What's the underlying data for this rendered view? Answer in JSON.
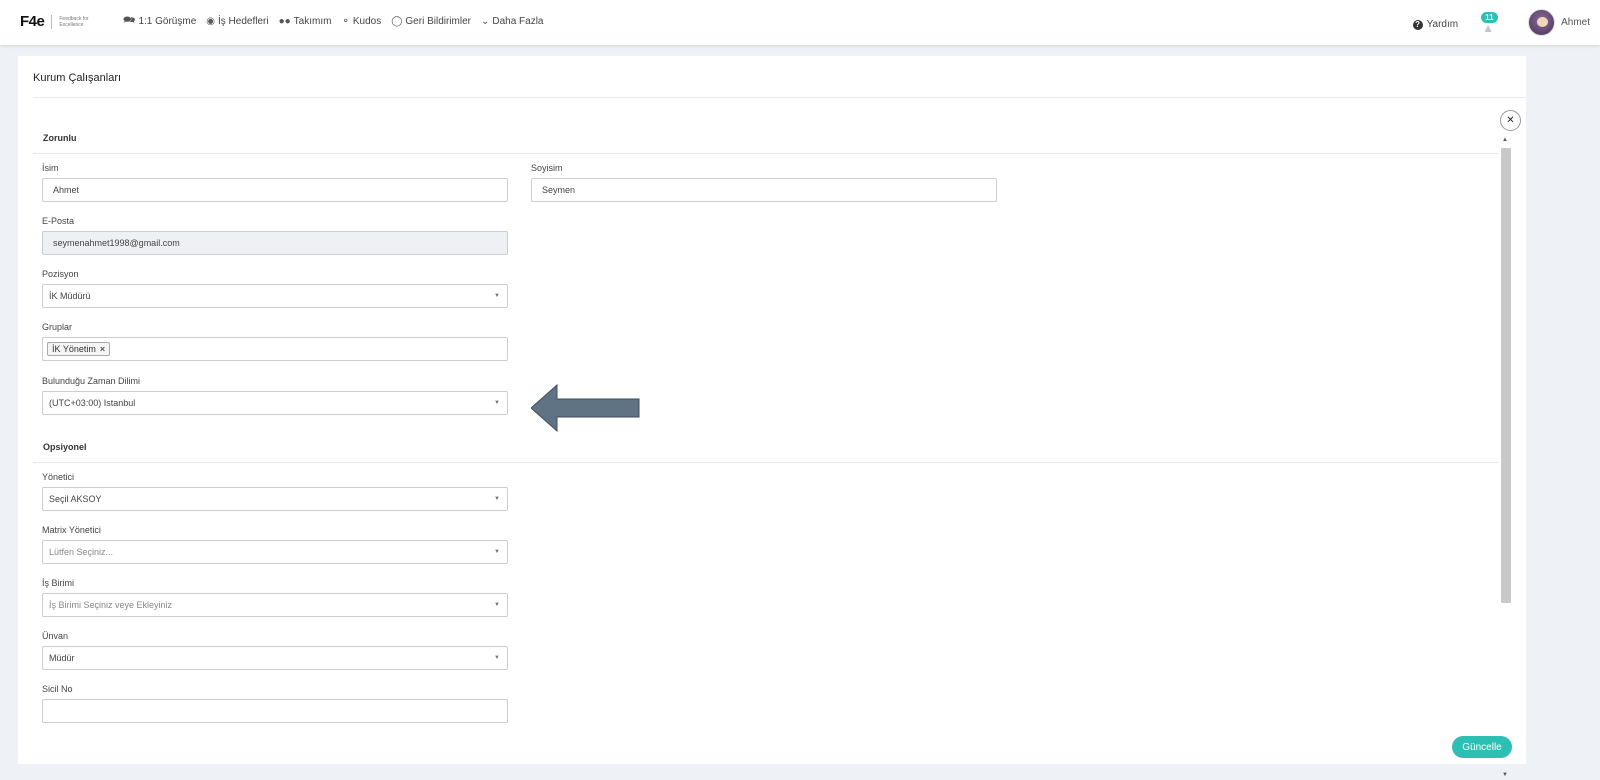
{
  "logo": {
    "mark": "F4e",
    "tagline": "Feedback for Excellence"
  },
  "nav": {
    "items": [
      {
        "label": "1:1 Görüşme",
        "icon": "chat-icon"
      },
      {
        "label": "İş Hedefleri",
        "icon": "target-icon"
      },
      {
        "label": "Takımım",
        "icon": "team-icon"
      },
      {
        "label": "Kudos",
        "icon": "award-icon"
      },
      {
        "label": "Geri Bildirimler",
        "icon": "comment-icon"
      },
      {
        "label": "Daha Fazla",
        "icon": "chevron-down-icon"
      }
    ],
    "help_label": "Yardım",
    "notification_count": "11",
    "user_name": "Ahmet"
  },
  "page": {
    "title": "Kurum Çalışanları",
    "submit_label": "Güncelle"
  },
  "form": {
    "required_section": "Zorunlu",
    "optional_section": "Opsiyonel",
    "first_name": {
      "label": "İsim",
      "value": "Ahmet"
    },
    "last_name": {
      "label": "Soyisim",
      "value": "Seymen"
    },
    "email": {
      "label": "E-Posta",
      "value": "seymenahmet1998@gmail.com"
    },
    "position": {
      "label": "Pozisyon",
      "value": "İK Müdürü"
    },
    "groups": {
      "label": "Gruplar",
      "tags": [
        "İK Yönetim"
      ]
    },
    "timezone": {
      "label": "Bulunduğu Zaman Dilimi",
      "value": "(UTC+03:00) Istanbul"
    },
    "manager": {
      "label": "Yönetici",
      "value": "Seçil AKSOY"
    },
    "matrix_manager": {
      "label": "Matrix Yönetici",
      "placeholder": "Lütfen Seçiniz..."
    },
    "business_unit": {
      "label": "İş Birimi",
      "placeholder": "İş Birimi Seçiniz veye Ekleyiniz"
    },
    "title_field": {
      "label": "Ünvan",
      "value": "Müdür"
    },
    "registry_no": {
      "label": "Sicil No",
      "value": ""
    }
  },
  "colors": {
    "accent": "#2cbfb3",
    "arrow": "#5f7384"
  }
}
